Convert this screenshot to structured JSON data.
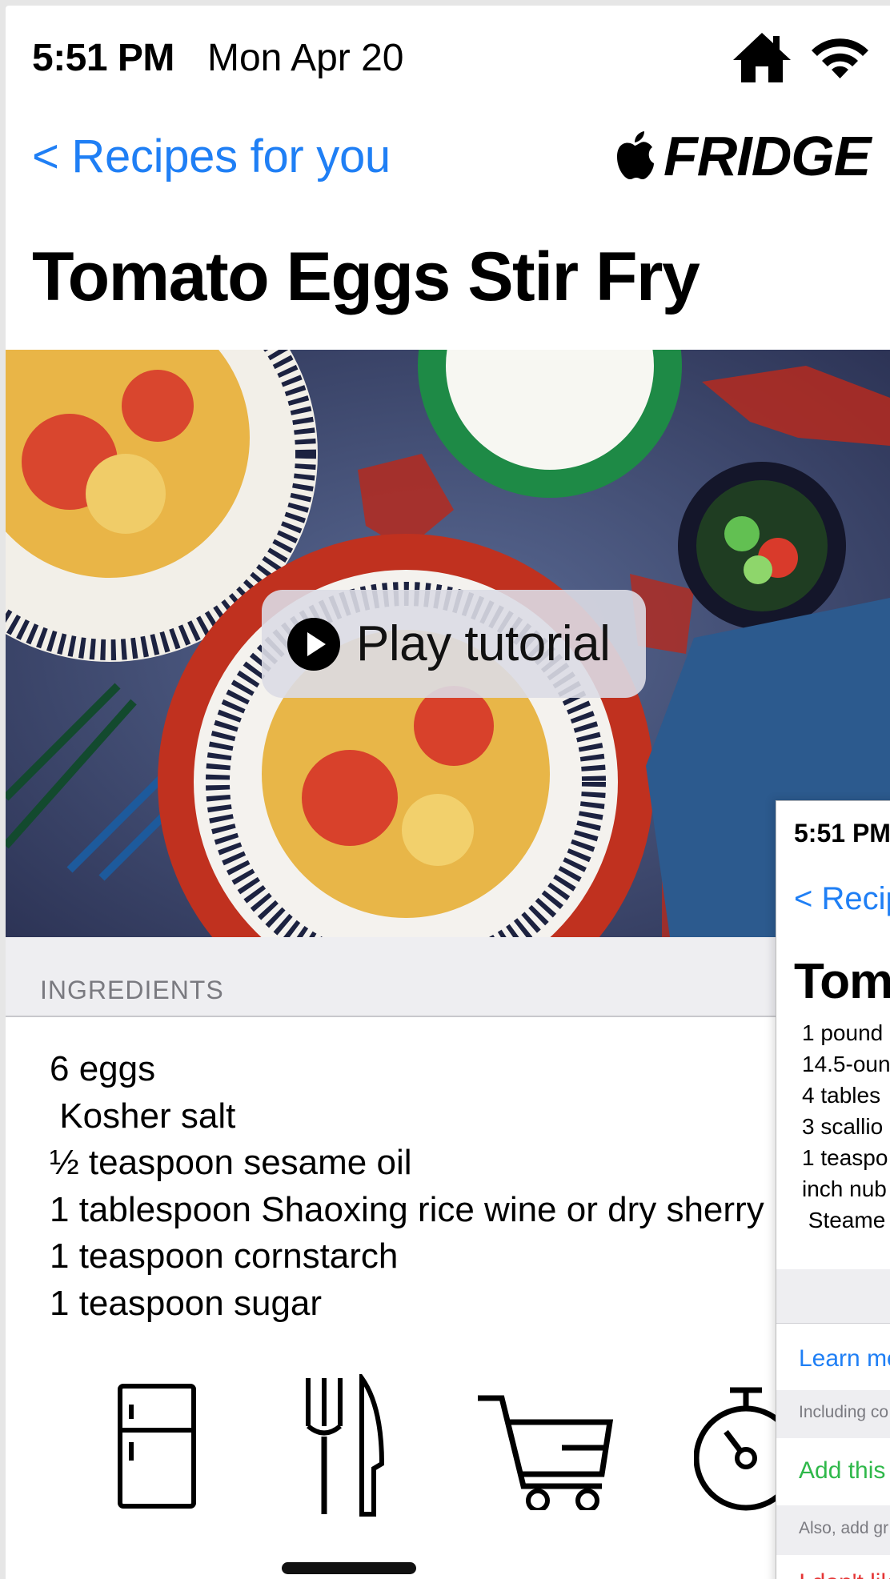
{
  "status_bar": {
    "time": "5:51 PM",
    "date": "Mon Apr 20"
  },
  "nav": {
    "back_label": "< Recipes for you",
    "brand": "FRIDGE"
  },
  "recipe": {
    "title": "Tomato Eggs Stir Fry",
    "play_label": "Play tutorial",
    "ingredients_header": "INGREDIENTS",
    "ingredients": "6 eggs\n Kosher salt\n½ teaspoon sesame oil\n1 tablespoon Shaoxing rice wine or dry sherry\n1 teaspoon cornstarch\n1 teaspoon sugar"
  },
  "tabs": [
    {
      "name": "fridge-icon"
    },
    {
      "name": "fork-knife-icon"
    },
    {
      "name": "cart-icon"
    },
    {
      "name": "timer-icon"
    }
  ],
  "overlay": {
    "time": "5:51 PM",
    "back_label": "< Recip",
    "title": "Toma",
    "ingredients": "1 pound\n14.5-oun\n4 tables\n3 scallio\n1 teaspo\ninch nub\n Steame",
    "learn_more": "Learn mo",
    "including": "Including co",
    "add_this": "Add this",
    "also_add": "Also, add gr",
    "dislike": "I don't lik"
  },
  "colors": {
    "link": "#1f7ff5",
    "green": "#2fb84a",
    "red": "#e53535",
    "section_bg": "#eeeef1"
  }
}
